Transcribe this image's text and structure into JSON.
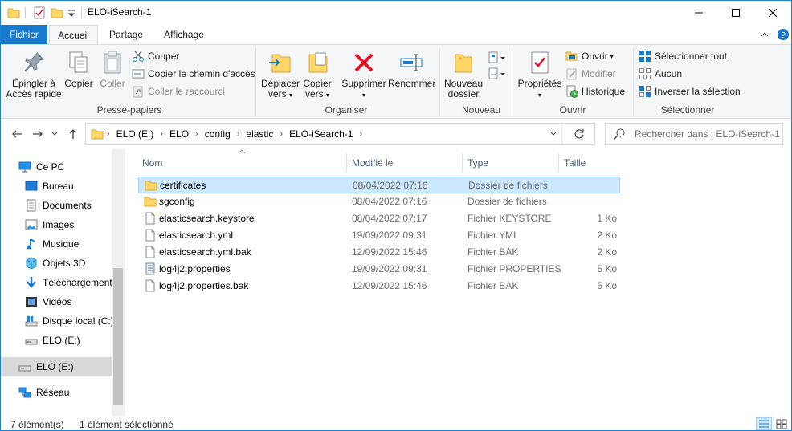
{
  "window": {
    "title": "ELO-iSearch-1",
    "controls": [
      "minimize",
      "maximize",
      "close"
    ]
  },
  "tabs": {
    "file": "Fichier",
    "home": "Accueil",
    "share": "Partage",
    "view": "Affichage"
  },
  "ribbon": {
    "clipboard": {
      "pin_line1": "Épingler à",
      "pin_line2": "Accès rapide",
      "copy": "Copier",
      "paste": "Coller",
      "cut": "Couper",
      "copy_path": "Copier le chemin d'accès",
      "paste_shortcut": "Coller le raccourci",
      "label": "Presse-papiers"
    },
    "organize": {
      "move_line1": "Déplacer",
      "move_line2": "vers",
      "copyto_line1": "Copier",
      "copyto_line2": "vers",
      "delete": "Supprimer",
      "rename": "Renommer",
      "label": "Organiser"
    },
    "new": {
      "folder_line1": "Nouveau",
      "folder_line2": "dossier",
      "label": "Nouveau"
    },
    "open": {
      "properties": "Propriétés",
      "open": "Ouvrir",
      "edit": "Modifier",
      "history": "Historique",
      "label": "Ouvrir"
    },
    "select": {
      "select_all": "Sélectionner tout",
      "select_none": "Aucun",
      "invert": "Inverser la sélection",
      "label": "Sélectionner"
    }
  },
  "address": {
    "crumbs": [
      "ELO (E:)",
      "ELO",
      "config",
      "elastic",
      "ELO-iSearch-1"
    ],
    "search_placeholder": "Rechercher dans : ELO-iSearch-1"
  },
  "navpane": {
    "items": [
      "Ce PC",
      "Bureau",
      "Documents",
      "Images",
      "Musique",
      "Objets 3D",
      "Téléchargements",
      "Vidéos",
      "Disque local (C:)",
      "ELO (E:)",
      "ELO (E:)",
      "Réseau"
    ]
  },
  "columns": {
    "name": "Nom",
    "modified": "Modifié le",
    "type": "Type",
    "size": "Taille"
  },
  "files": [
    {
      "name": "certificates",
      "modified": "08/04/2022 07:16",
      "type": "Dossier de fichiers",
      "size": "",
      "icon": "folder-icon"
    },
    {
      "name": "sgconfig",
      "modified": "08/04/2022 07:16",
      "type": "Dossier de fichiers",
      "size": "",
      "icon": "folder-icon"
    },
    {
      "name": "elasticsearch.keystore",
      "modified": "08/04/2022 07:17",
      "type": "Fichier KEYSTORE",
      "size": "1 Ko",
      "icon": "file-icon"
    },
    {
      "name": "elasticsearch.yml",
      "modified": "19/09/2022 09:31",
      "type": "Fichier YML",
      "size": "2 Ko",
      "icon": "file-icon"
    },
    {
      "name": "elasticsearch.yml.bak",
      "modified": "12/09/2022 15:46",
      "type": "Fichier BAK",
      "size": "2 Ko",
      "icon": "file-icon"
    },
    {
      "name": "log4j2.properties",
      "modified": "19/09/2022 09:31",
      "type": "Fichier PROPERTIES",
      "size": "5 Ko",
      "icon": "properties-file-icon"
    },
    {
      "name": "log4j2.properties.bak",
      "modified": "12/09/2022 15:46",
      "type": "Fichier BAK",
      "size": "5 Ko",
      "icon": "file-icon"
    }
  ],
  "status": {
    "count": "7 élément(s)",
    "selection": "1 élément sélectionné"
  },
  "colors": {
    "accent": "#1979ca",
    "selection": "#cce8ff",
    "selection_border": "#99d1ff",
    "delete_red": "#e81123",
    "folder_yellow": "#ffd766"
  }
}
